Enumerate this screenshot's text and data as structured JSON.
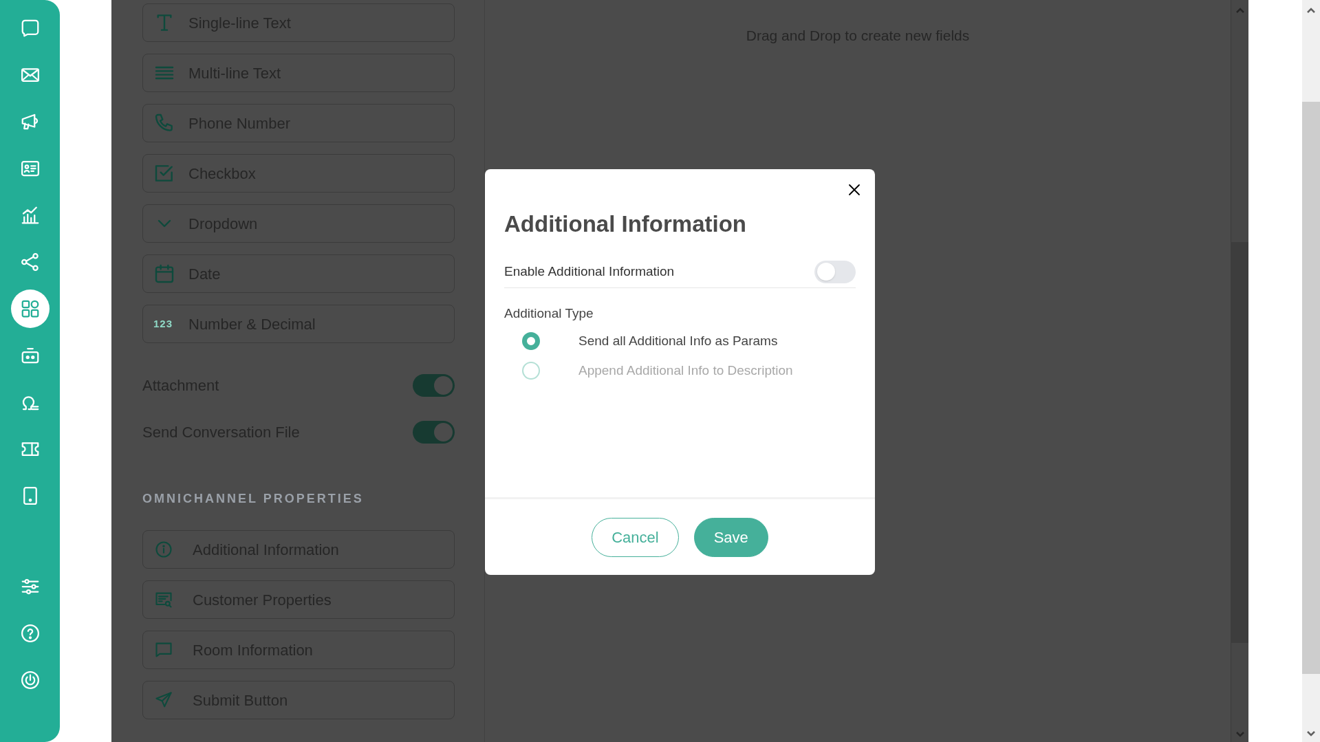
{
  "nav_items": [
    {
      "selected": false
    },
    {
      "selected": false
    },
    {
      "selected": false
    },
    {
      "selected": false
    },
    {
      "selected": false
    },
    {
      "selected": false
    },
    {
      "selected": true
    },
    {
      "selected": false
    },
    {
      "selected": false
    },
    {
      "selected": false
    },
    {
      "selected": false
    }
  ],
  "nav_bottom_items": [
    {
      "selected": false
    },
    {
      "selected": false
    },
    {
      "selected": false
    }
  ],
  "field_types": [
    {
      "label": "Single-line Text"
    },
    {
      "label": "Multi-line Text"
    },
    {
      "label": "Phone Number"
    },
    {
      "label": "Checkbox"
    },
    {
      "label": "Dropdown"
    },
    {
      "label": "Date"
    },
    {
      "label": "Number & Decimal",
      "icon_text": "123"
    }
  ],
  "toggles": [
    {
      "label": "Attachment",
      "on": true
    },
    {
      "label": "Send Conversation File",
      "on": true
    }
  ],
  "section_heading": "OMNICHANNEL PROPERTIES",
  "omnichannel_items": [
    {
      "label": "Additional Information"
    },
    {
      "label": "Customer Properties"
    },
    {
      "label": "Room Information"
    },
    {
      "label": "Submit Button"
    }
  ],
  "canvas_hint": "Drag and Drop to create new fields",
  "dialog": {
    "title": "Additional Information",
    "enable": {
      "label": "Enable Additional Information",
      "on": false
    },
    "type_label": "Additional Type",
    "options": [
      {
        "label": "Send all Additional Info as Params",
        "selected": true
      },
      {
        "label": "Append Additional Info to Description",
        "selected": false
      }
    ],
    "buttons": [
      {
        "label": "Cancel",
        "kind": "secondary"
      },
      {
        "label": "Save",
        "kind": "primary"
      }
    ]
  }
}
